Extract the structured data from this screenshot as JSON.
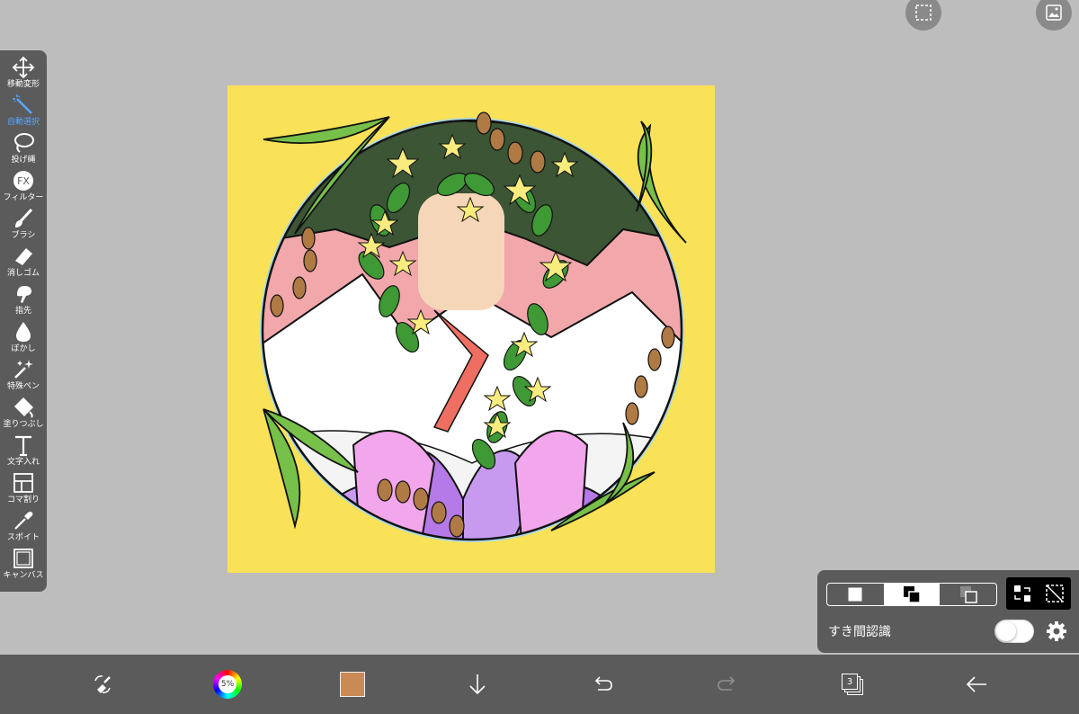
{
  "tools": [
    {
      "id": "move",
      "label": "移動変形",
      "icon": "move-icon",
      "active": false
    },
    {
      "id": "autoselect",
      "label": "自動選択",
      "icon": "magic-wand-icon",
      "active": true
    },
    {
      "id": "lasso",
      "label": "投げ縄",
      "icon": "lasso-icon",
      "active": false
    },
    {
      "id": "filter",
      "label": "フィルター",
      "icon": "fx-icon",
      "active": false
    },
    {
      "id": "brush",
      "label": "ブラシ",
      "icon": "brush-icon",
      "active": false
    },
    {
      "id": "eraser",
      "label": "消しゴム",
      "icon": "eraser-icon",
      "active": false
    },
    {
      "id": "smudge",
      "label": "指先",
      "icon": "finger-icon",
      "active": false
    },
    {
      "id": "blur",
      "label": "ぼかし",
      "icon": "drop-icon",
      "active": false
    },
    {
      "id": "special",
      "label": "特殊ペン",
      "icon": "sparkle-pen-icon",
      "active": false
    },
    {
      "id": "fill",
      "label": "塗りつぶし",
      "icon": "bucket-icon",
      "active": false
    },
    {
      "id": "text",
      "label": "文字入れ",
      "icon": "text-icon",
      "active": false
    },
    {
      "id": "frame",
      "label": "コマ割り",
      "icon": "frame-divide-icon",
      "active": false
    },
    {
      "id": "eyedropper",
      "label": "スポイト",
      "icon": "eyedropper-icon",
      "active": false
    },
    {
      "id": "canvas",
      "label": "キャンバス",
      "icon": "canvas-icon",
      "active": false
    }
  ],
  "selection_panel": {
    "gap_label": "すき間認識",
    "gap_toggle_on": false
  },
  "bottom": {
    "color_wheel_text": "5%",
    "current_color": "#c98a55",
    "layer_count": "3"
  },
  "colors": {
    "accent": "#5aa6ff",
    "toolbar_bg": "#5b5b5b",
    "workspace_bg": "#bdbdbd"
  }
}
